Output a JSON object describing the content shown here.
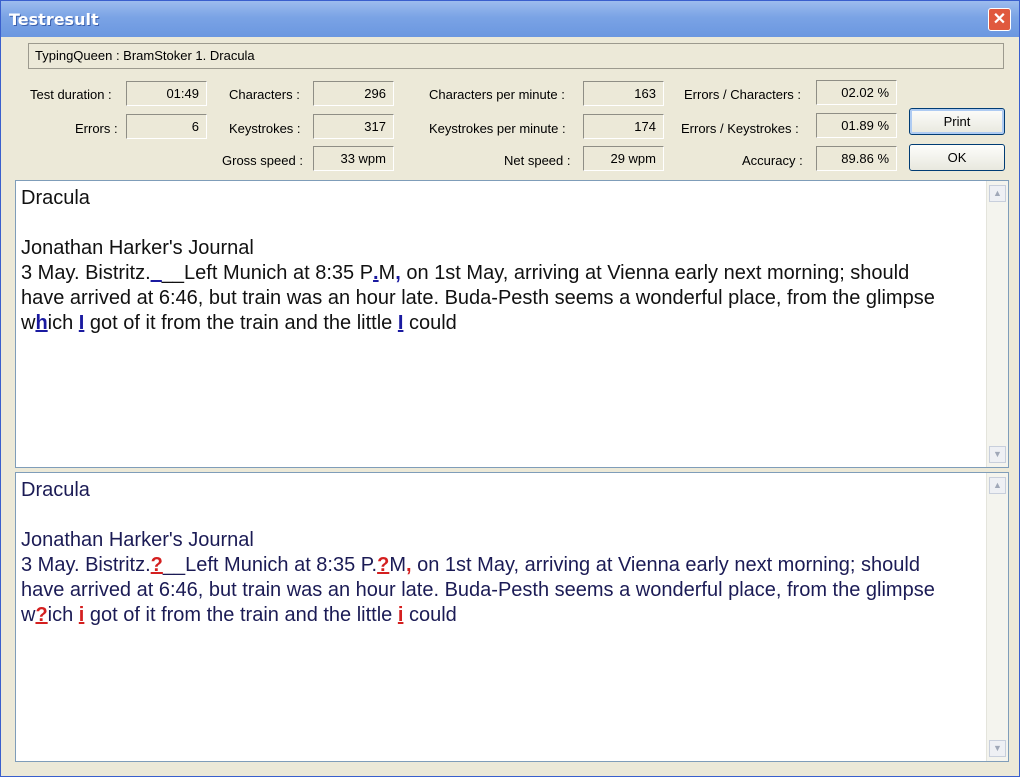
{
  "window": {
    "title": "Testresult",
    "close_glyph": "✕"
  },
  "test": {
    "name": "TypingQueen : BramStoker 1. Dracula"
  },
  "stats": {
    "test_duration": {
      "label": "Test duration :",
      "value": "01:49"
    },
    "errors": {
      "label": "Errors :",
      "value": "6"
    },
    "characters": {
      "label": "Characters :",
      "value": "296"
    },
    "keystrokes": {
      "label": "Keystrokes :",
      "value": "317"
    },
    "gross_speed": {
      "label": "Gross speed :",
      "value": "33 wpm"
    },
    "chars_per_minute": {
      "label": "Characters per minute :",
      "value": "163"
    },
    "keys_per_minute": {
      "label": "Keystrokes per minute :",
      "value": "174"
    },
    "net_speed": {
      "label": "Net speed :",
      "value": "29 wpm"
    },
    "errors_chars": {
      "label": "Errors / Characters :",
      "value": "02.02 %"
    },
    "errors_keys": {
      "label": "Errors / Keystrokes :",
      "value": "01.89 %"
    },
    "accuracy": {
      "label": "Accuracy :",
      "value": "89.86 %"
    }
  },
  "buttons": {
    "print": "Print",
    "ok": "OK"
  },
  "source_text": {
    "title": "Dracula",
    "subtitle": "Jonathan Harker's Journal",
    "line1_a": "3 May. Bistritz.",
    "line1_err1": "_",
    "line1_b": "__Left Munich at 8:35 P",
    "line1_err2": ".",
    "line1_c": "M",
    "line1_err3": ",",
    "line1_d": " on 1st May, arriving at Vienna early next morning; should",
    "line2": "have arrived at 6:46, but train was an hour late. Buda-Pesth seems a wonderful place, from the glimpse",
    "line3_a": "w",
    "line3_err1": "h",
    "line3_b": "ich ",
    "line3_err2": "I",
    "line3_c": " got of it from the train and the little ",
    "line3_err3": "I",
    "line3_d": " could"
  },
  "typed_text": {
    "title": "Dracula",
    "subtitle": "Jonathan Harker's Journal",
    "line1_a": "3 May. Bistritz.",
    "line1_err1": "?",
    "line1_b": "__Left Munich at 8:35 P.",
    "line1_err2": "?",
    "line1_c": "M",
    "line1_err3": ",",
    "line1_d": " on 1st May, arriving at Vienna early next morning; should",
    "line2": "have arrived at 6:46, but train was an hour late. Buda-Pesth seems a wonderful place, from the glimpse",
    "line3_a": "w",
    "line3_err1": "?",
    "line3_b": "ich ",
    "line3_err2": "i",
    "line3_c": " got of it from the train and the little ",
    "line3_err3": "i",
    "line3_d": " could"
  },
  "scrollbar": {
    "up_glyph": "▲",
    "down_glyph": "▼"
  },
  "colors": {
    "titlebar": "#7aa3e5",
    "window_bg": "#ece9d8",
    "error_source": "#1a1aa0",
    "error_typed": "#d41f1f"
  }
}
